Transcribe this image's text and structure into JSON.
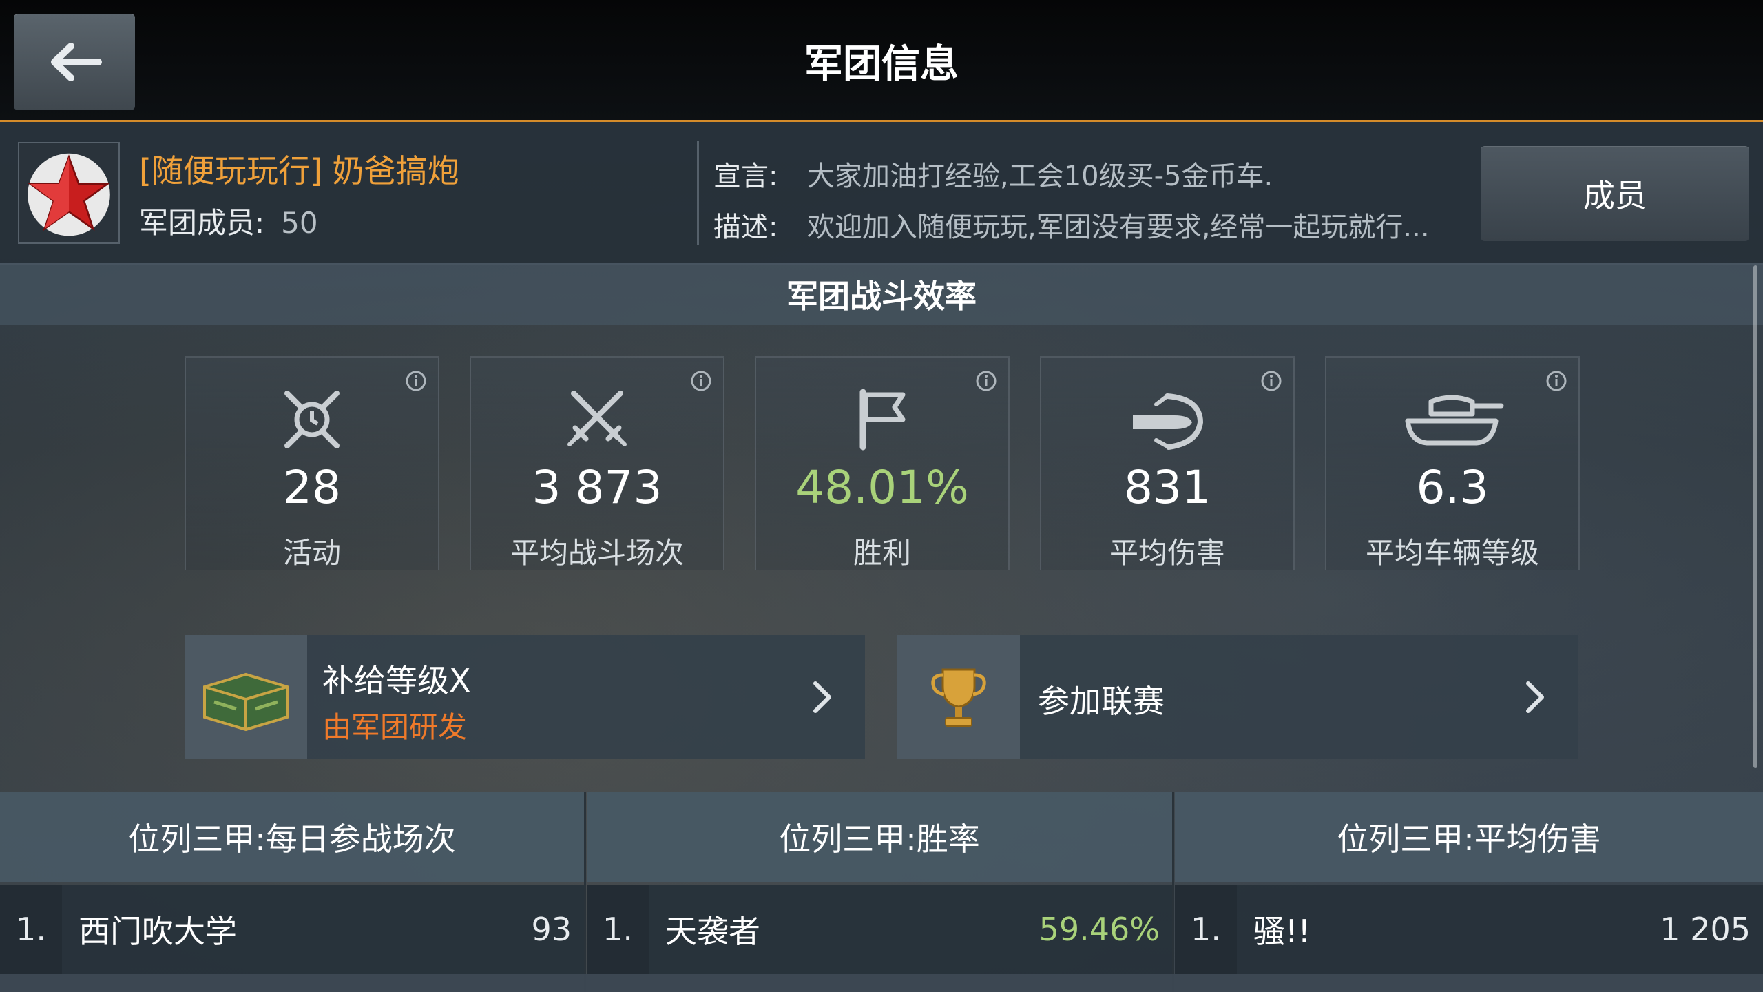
{
  "header": {
    "title": "军团信息",
    "back_icon": "back-arrow-icon"
  },
  "clan": {
    "name": "[随便玩玩行] 奶爸搞炮",
    "members_label": "军团成员:",
    "members_count": "50",
    "motto_label": "宣言:",
    "motto": "大家加油打经验,工会10级买-5金币车.",
    "description_label": "描述:",
    "description": "欢迎加入随便玩玩,军团没有要求,经常一起玩就行...",
    "members_button": "成员",
    "emblem_color": "#c81e1e"
  },
  "efficiency": {
    "title": "军团战斗效率",
    "stats": [
      {
        "value": "28",
        "label": "活动",
        "icon": "activity-icon",
        "color": "#ffffff"
      },
      {
        "value": "3 873",
        "label": "平均战斗场次",
        "icon": "crossed-swords-icon",
        "color": "#ffffff"
      },
      {
        "value": "48.01%",
        "label": "胜利",
        "icon": "flag-icon",
        "color": "#a9d27a"
      },
      {
        "value": "831",
        "label": "平均伤害",
        "icon": "shell-damage-icon",
        "color": "#ffffff"
      },
      {
        "value": "6.3",
        "label": "平均车辆等级",
        "icon": "tank-icon",
        "color": "#ffffff"
      }
    ]
  },
  "supply": {
    "title": "补给等级X",
    "subtitle": "由军团研发",
    "icon": "supply-crate-icon"
  },
  "tournament": {
    "title": "参加联赛",
    "icon": "trophy-icon"
  },
  "leaderboards": [
    {
      "title": "位列三甲:每日参战场次",
      "rank": "1.",
      "name": "西门吹大学",
      "value": "93",
      "value_color": "#e8ecef"
    },
    {
      "title": "位列三甲:胜率",
      "rank": "1.",
      "name": "天袭者",
      "value": "59.46%",
      "value_color": "#a9d27a"
    },
    {
      "title": "位列三甲:平均伤害",
      "rank": "1.",
      "name": "骚!!",
      "value": "1 205",
      "value_color": "#e8ecef"
    }
  ],
  "accent_color": "#d48b2a"
}
